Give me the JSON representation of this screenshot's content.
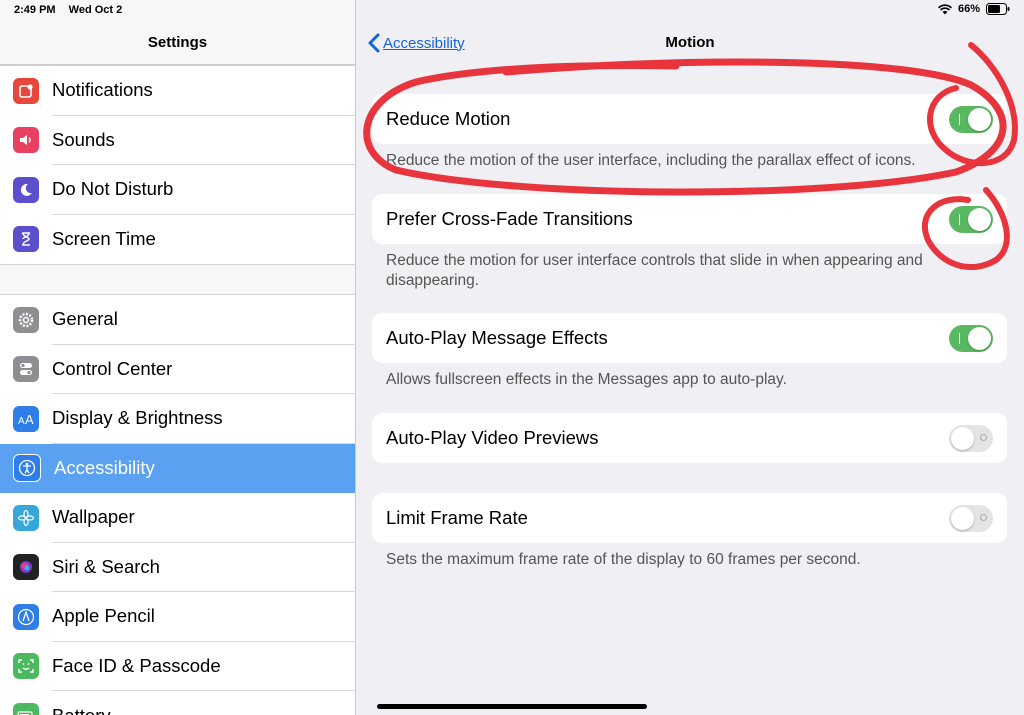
{
  "status_bar": {
    "time": "2:49 PM",
    "date": "Wed Oct 2",
    "battery": "66%"
  },
  "sidebar": {
    "title": "Settings",
    "group1": [
      {
        "label": "Notifications",
        "color": "#e8483b",
        "icon": "notifications-icon"
      },
      {
        "label": "Sounds",
        "color": "#e74060",
        "icon": "sounds-icon"
      },
      {
        "label": "Do Not Disturb",
        "color": "#5b4fce",
        "icon": "moon-icon"
      },
      {
        "label": "Screen Time",
        "color": "#5b4fce",
        "icon": "hourglass-icon"
      }
    ],
    "group2": [
      {
        "label": "General",
        "color": "#8e8e93",
        "icon": "gear-icon"
      },
      {
        "label": "Control Center",
        "color": "#8e8e93",
        "icon": "switches-icon"
      },
      {
        "label": "Display & Brightness",
        "color": "#2f7ee8",
        "icon": "text-size-icon"
      },
      {
        "label": "Accessibility",
        "color": "#2f7ee8",
        "icon": "accessibility-icon",
        "selected": true
      },
      {
        "label": "Wallpaper",
        "color": "#37a6d9",
        "icon": "flower-icon"
      },
      {
        "label": "Siri & Search",
        "color": "#222222",
        "icon": "siri-icon"
      },
      {
        "label": "Apple Pencil",
        "color": "#2f7ee8",
        "icon": "pencil-icon"
      },
      {
        "label": "Face ID & Passcode",
        "color": "#4cb85f",
        "icon": "face-id-icon"
      },
      {
        "label": "Battery",
        "color": "#4cb85f",
        "icon": "battery-icon"
      }
    ]
  },
  "nav": {
    "back_label": "Accessibility",
    "title": "Motion"
  },
  "settings": [
    {
      "label": "Reduce Motion",
      "on": true,
      "description": "Reduce the motion of the user interface, including the parallax effect of icons."
    },
    {
      "label": "Prefer Cross-Fade Transitions",
      "on": true,
      "description": "Reduce the motion for user interface controls that slide in when appearing and disappearing."
    },
    {
      "label": "Auto-Play Message Effects",
      "on": true,
      "description": "Allows fullscreen effects in the Messages app to auto-play."
    },
    {
      "label": "Auto-Play Video Previews",
      "on": false,
      "description": ""
    },
    {
      "label": "Limit Frame Rate",
      "on": false,
      "description": "Sets the maximum frame rate of the display to 60 frames per second."
    }
  ],
  "annotation_color": "#e8343c"
}
